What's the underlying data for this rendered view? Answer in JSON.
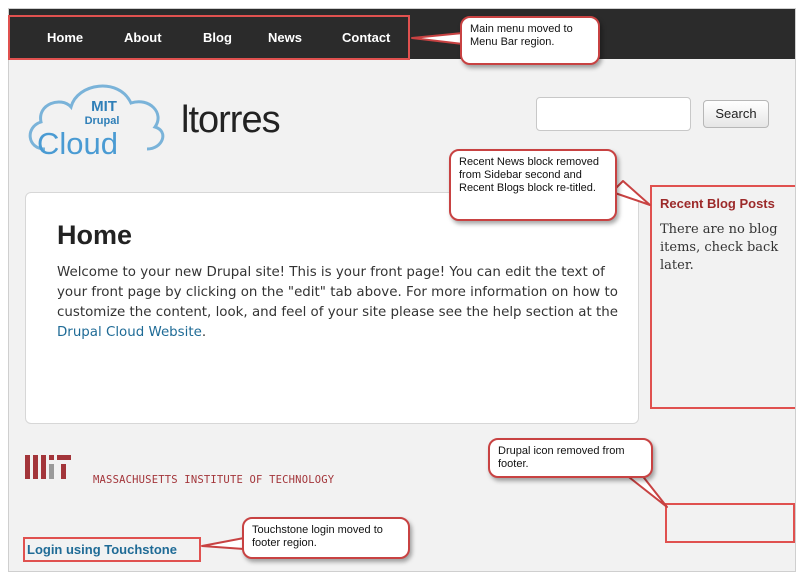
{
  "menu": {
    "items": [
      {
        "label": "Home"
      },
      {
        "label": "About"
      },
      {
        "label": "Blog"
      },
      {
        "label": "News"
      },
      {
        "label": "Contact"
      }
    ]
  },
  "site": {
    "logo_words": [
      "MIT",
      "Drupal",
      "Cloud"
    ],
    "name": "ltorres"
  },
  "search": {
    "value": "",
    "button_label": "Search"
  },
  "main": {
    "title": "Home",
    "body_text": "Welcome to your new Drupal site! This is your front page! You can edit the text of your front page by clicking on the \"edit\" tab above. For more information on how to customize the content, look, and feel of your site please see the help section at the ",
    "link_text": "Drupal Cloud Website",
    "after_link": "."
  },
  "sidebar": {
    "title": "Recent Blog Posts",
    "text": "There are no blog items, check back later."
  },
  "footer": {
    "mit_text": "MASSACHUSETTS INSTITUTE OF TECHNOLOGY",
    "login_label": "Login using Touchstone"
  },
  "callouts": {
    "menu": "Main menu moved to Menu Bar region.",
    "news": "Recent News block removed from Sidebar second and Recent Blogs block re-titled.",
    "drupal": "Drupal icon removed from footer.",
    "touchstone": "Touchstone login moved to footer region."
  },
  "colors": {
    "menubar_bg": "#2b2b2b",
    "highlight_border": "#e0514f",
    "link": "#1f6b96",
    "sidebar_title": "#9c2a2a",
    "mit_red": "#a3353a"
  }
}
